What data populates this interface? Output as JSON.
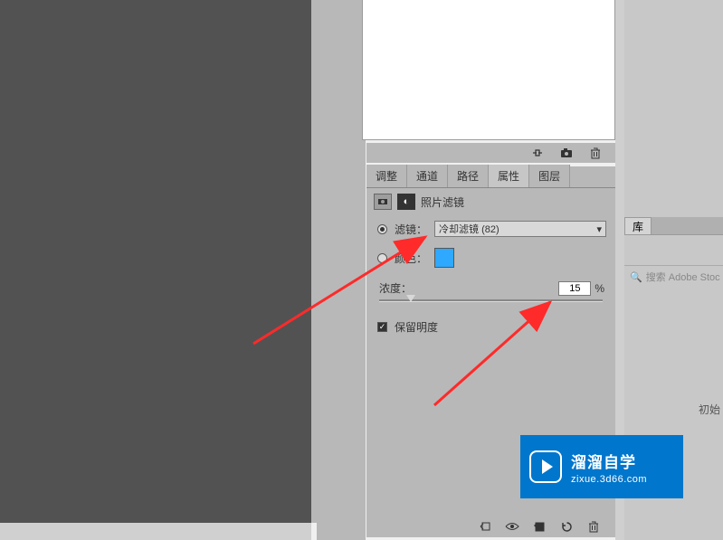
{
  "tabs": {
    "adjust": "调整",
    "channel": "通道",
    "path": "路径",
    "property": "属性",
    "layer": "图层"
  },
  "props": {
    "title": "照片滤镜",
    "filter_label": "滤镜：",
    "filter_value": "冷却滤镜 (82)",
    "color_label": "颜色：",
    "color_value": "#2ea9ff",
    "density_label": "浓度：",
    "density_value": "15",
    "density_unit": "%",
    "preserve_label": "保留明度"
  },
  "library": {
    "tab": "库",
    "search_placeholder": "",
    "adobe_stock": "搜索 Adobe Stoc",
    "init_text": "初始"
  },
  "watermark": {
    "title": "溜溜自学",
    "url": "zixue.3d66.com"
  },
  "icons": {
    "link": "link-icon",
    "camera": "camera-icon",
    "trash": "trash-icon",
    "clip": "clip-icon",
    "eye": "eye-icon",
    "reset": "reset-icon",
    "prev": "prev-icon",
    "mask": "mask-icon",
    "search": "search-icon",
    "chevron": "chevron-down-icon"
  }
}
